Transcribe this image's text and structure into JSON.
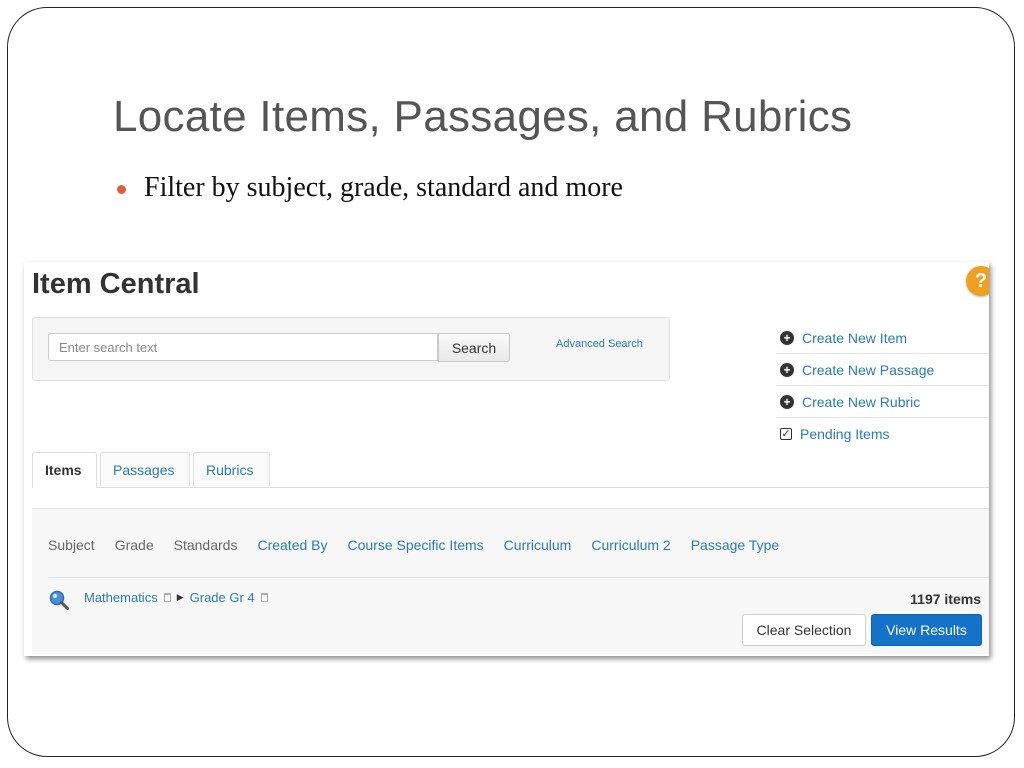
{
  "slide": {
    "title": "Locate Items, Passages, and Rubrics",
    "bullet": "Filter by subject, grade, standard and more"
  },
  "app": {
    "title": "Item Central",
    "help_glyph": "?"
  },
  "search": {
    "placeholder": "Enter search text",
    "button_label": "Search",
    "advanced_label": "Advanced Search"
  },
  "actions": [
    {
      "label": "Create New Item",
      "icon": "plus-circle-icon"
    },
    {
      "label": "Create New Passage",
      "icon": "plus-circle-icon"
    },
    {
      "label": "Create New Rubric",
      "icon": "plus-circle-icon"
    },
    {
      "label": "Pending Items",
      "icon": "checkbox-icon"
    }
  ],
  "tabs": [
    {
      "label": "Items",
      "active": true
    },
    {
      "label": "Passages",
      "active": false
    },
    {
      "label": "Rubrics",
      "active": false
    }
  ],
  "facets": [
    {
      "label": "Subject",
      "link": false
    },
    {
      "label": "Grade",
      "link": false
    },
    {
      "label": "Standards",
      "link": false
    },
    {
      "label": "Created By",
      "link": true
    },
    {
      "label": "Course Specific Items",
      "link": true
    },
    {
      "label": "Curriculum",
      "link": true
    },
    {
      "label": "Curriculum 2",
      "link": true
    },
    {
      "label": "Passage Type",
      "link": true
    }
  ],
  "selection": {
    "crumbs": [
      "Mathematics",
      "Grade Gr 4"
    ],
    "count_label": "1197 items"
  },
  "buttons": {
    "clear": "Clear Selection",
    "view": "View Results"
  },
  "colors": {
    "link": "#2a7ab8",
    "primary_button": "#1572c9",
    "bullet_accent": "#d9603b",
    "help_badge": "#f0a020"
  }
}
